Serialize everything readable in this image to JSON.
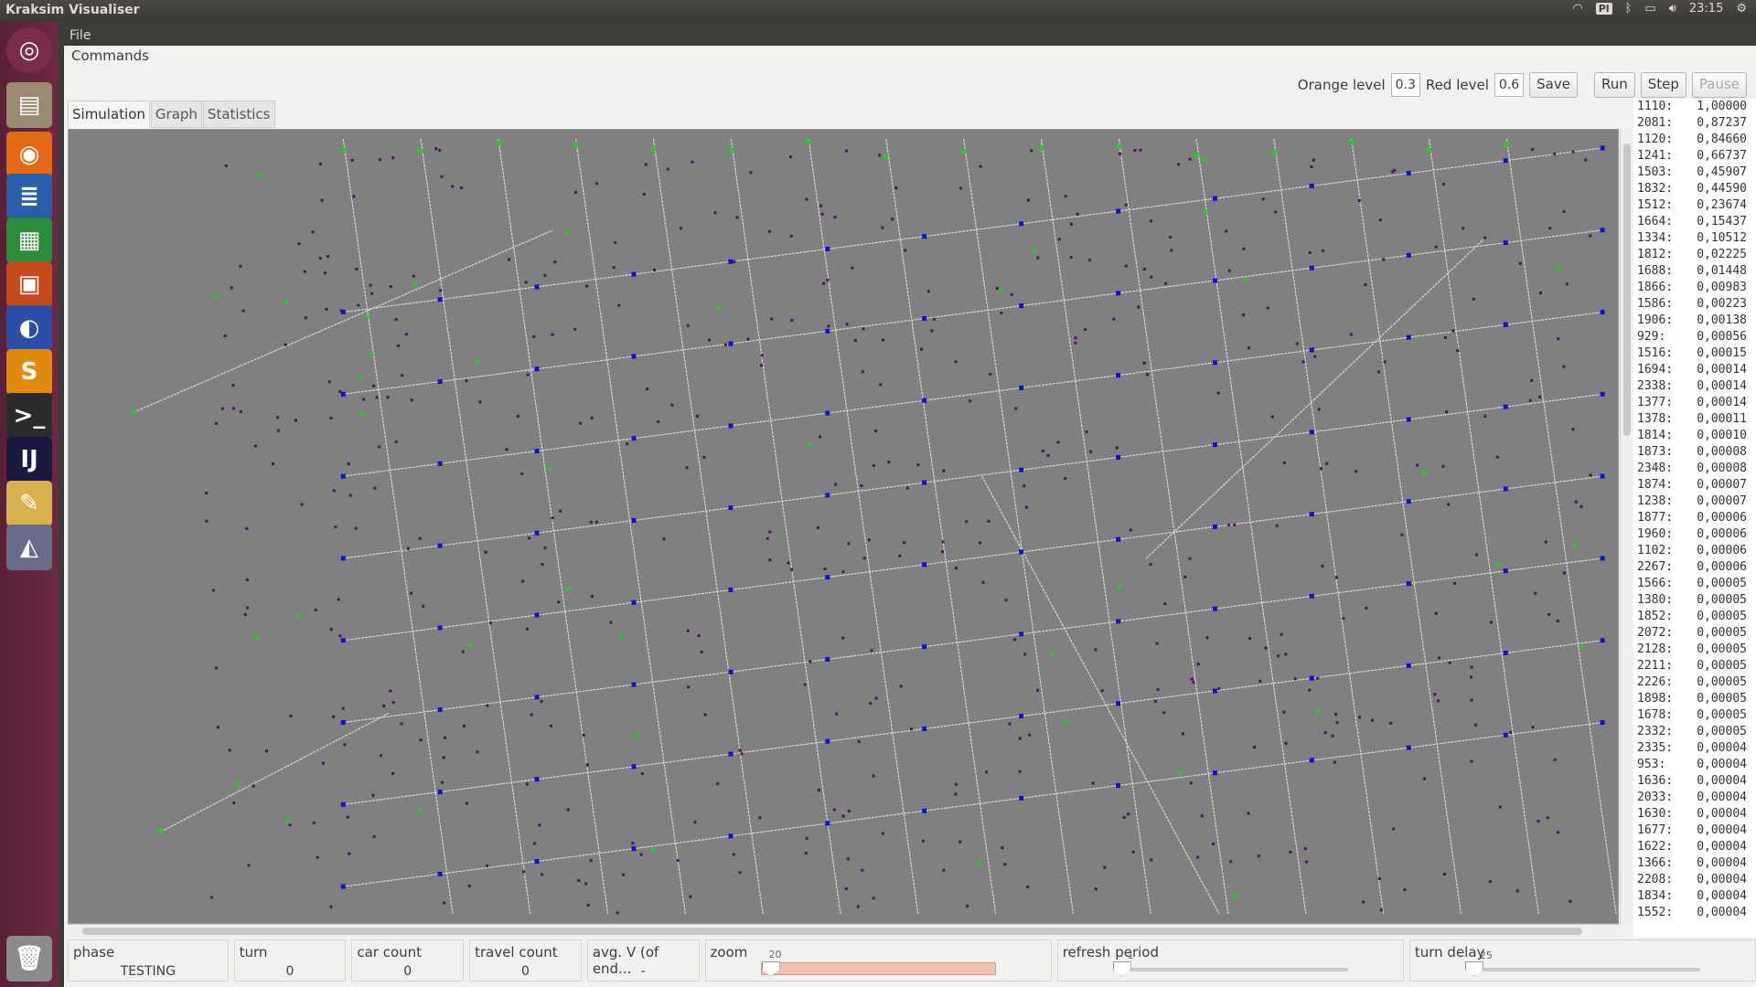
{
  "topbar": {
    "title": "Kraksim Visualiser",
    "keyboard": "Pl",
    "time": "23:15"
  },
  "menu": {
    "file": "File"
  },
  "commands_label": "Commands",
  "controls": {
    "orange_label": "Orange level",
    "orange_value": "0.3",
    "red_label": "Red level",
    "red_value": "0.6",
    "save": "Save",
    "run": "Run",
    "step": "Step",
    "pause": "Pause"
  },
  "tabs": [
    "Simulation",
    "Graph",
    "Statistics"
  ],
  "stats": [
    [
      "1110:",
      "1,00000"
    ],
    [
      "2081:",
      "0,87237"
    ],
    [
      "1120:",
      "0,84660"
    ],
    [
      "1241:",
      "0,66737"
    ],
    [
      "1503:",
      "0,45907"
    ],
    [
      "1832:",
      "0,44590"
    ],
    [
      "1512:",
      "0,23674"
    ],
    [
      "1664:",
      "0,15437"
    ],
    [
      "1334:",
      "0,10512"
    ],
    [
      "1812:",
      "0,02225"
    ],
    [
      "1688:",
      "0,01448"
    ],
    [
      "1866:",
      "0,00983"
    ],
    [
      "1586:",
      "0,00223"
    ],
    [
      "1906:",
      "0,00138"
    ],
    [
      "929:",
      "0,00056"
    ],
    [
      "1516:",
      "0,00015"
    ],
    [
      "1694:",
      "0,00014"
    ],
    [
      "2338:",
      "0,00014"
    ],
    [
      "1377:",
      "0,00014"
    ],
    [
      "1378:",
      "0,00011"
    ],
    [
      "1814:",
      "0,00010"
    ],
    [
      "1873:",
      "0,00008"
    ],
    [
      "2348:",
      "0,00008"
    ],
    [
      "1874:",
      "0,00007"
    ],
    [
      "1238:",
      "0,00007"
    ],
    [
      "1877:",
      "0,00006"
    ],
    [
      "1960:",
      "0,00006"
    ],
    [
      "1102:",
      "0,00006"
    ],
    [
      "2267:",
      "0,00006"
    ],
    [
      "1566:",
      "0,00005"
    ],
    [
      "1380:",
      "0,00005"
    ],
    [
      "1852:",
      "0,00005"
    ],
    [
      "2072:",
      "0,00005"
    ],
    [
      "2128:",
      "0,00005"
    ],
    [
      "2211:",
      "0,00005"
    ],
    [
      "2226:",
      "0,00005"
    ],
    [
      "1898:",
      "0,00005"
    ],
    [
      "1678:",
      "0,00005"
    ],
    [
      "2332:",
      "0,00005"
    ],
    [
      "2335:",
      "0,00004"
    ],
    [
      "953:",
      "0,00004"
    ],
    [
      "1636:",
      "0,00004"
    ],
    [
      "2033:",
      "0,00004"
    ],
    [
      "1630:",
      "0,00004"
    ],
    [
      "1677:",
      "0,00004"
    ],
    [
      "1622:",
      "0,00004"
    ],
    [
      "1366:",
      "0,00004"
    ],
    [
      "2208:",
      "0,00004"
    ],
    [
      "1834:",
      "0,00004"
    ],
    [
      "1552:",
      "0,00004"
    ]
  ],
  "bottom": {
    "phase_label": "phase",
    "phase_value": "TESTING",
    "turn_label": "turn",
    "turn_value": "0",
    "car_label": "car count",
    "car_value": "0",
    "travel_label": "travel count",
    "travel_value": "0",
    "avgv_label": "avg. V (of end...",
    "avgv_value": "-",
    "zoom_label": "zoom",
    "zoom_tick": "20",
    "zoom_level": 0.0,
    "refresh_label": "refresh period",
    "refresh_tick": "1",
    "refresh_level": 0.0,
    "delay_label": "turn delay",
    "delay_tick": "25",
    "delay_level": 0.0
  },
  "colors": {
    "node": "#1010d0",
    "source": "#20d020",
    "car": "#501060",
    "road": "#d8d8d8",
    "map_bg": "#808080"
  }
}
